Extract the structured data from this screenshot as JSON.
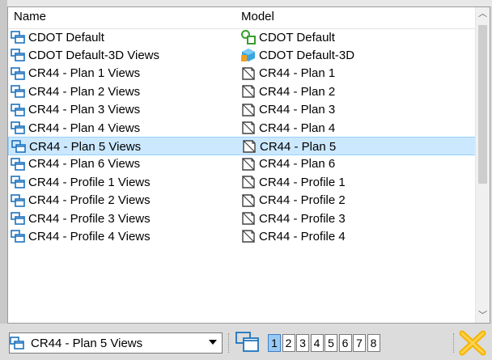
{
  "dropdown": {
    "headers": {
      "name": "Name",
      "model": "Model"
    },
    "rows": [
      {
        "name": "CDOT Default",
        "model": "CDOT Default",
        "model_icon": "design-model-icon",
        "selected": false
      },
      {
        "name": "CDOT Default-3D Views",
        "model": "CDOT Default-3D",
        "model_icon": "3d-model-icon",
        "selected": false
      },
      {
        "name": "CR44 - Plan 1 Views",
        "model": "CR44 - Plan 1",
        "model_icon": "sheet-model-icon",
        "selected": false
      },
      {
        "name": "CR44 - Plan 2 Views",
        "model": "CR44 - Plan 2",
        "model_icon": "sheet-model-icon",
        "selected": false
      },
      {
        "name": "CR44 - Plan 3 Views",
        "model": "CR44 - Plan 3",
        "model_icon": "sheet-model-icon",
        "selected": false
      },
      {
        "name": "CR44 - Plan 4 Views",
        "model": "CR44 - Plan 4",
        "model_icon": "sheet-model-icon",
        "selected": false
      },
      {
        "name": "CR44 - Plan 5 Views",
        "model": "CR44 - Plan 5",
        "model_icon": "sheet-model-icon",
        "selected": true
      },
      {
        "name": "CR44 - Plan 6 Views",
        "model": "CR44 - Plan 6",
        "model_icon": "sheet-model-icon",
        "selected": false
      },
      {
        "name": "CR44 - Profile 1 Views",
        "model": "CR44 - Profile 1",
        "model_icon": "sheet-model-icon",
        "selected": false
      },
      {
        "name": "CR44 - Profile 2 Views",
        "model": "CR44 - Profile 2",
        "model_icon": "sheet-model-icon",
        "selected": false
      },
      {
        "name": "CR44 - Profile 3 Views",
        "model": "CR44 - Profile 3",
        "model_icon": "sheet-model-icon",
        "selected": false
      },
      {
        "name": "CR44 - Profile 4 Views",
        "model": "CR44 - Profile 4",
        "model_icon": "sheet-model-icon",
        "selected": false
      }
    ]
  },
  "toolbar": {
    "combo_value": "CR44 - Plan 5 Views",
    "view_buttons": [
      "1",
      "2",
      "3",
      "4",
      "5",
      "6",
      "7",
      "8"
    ],
    "active_view": "1"
  },
  "colors": {
    "selection": "#cce8ff",
    "selection_border": "#99d1ff",
    "view_icon": "#1e73be",
    "active_view_button": "#99c9f5"
  }
}
